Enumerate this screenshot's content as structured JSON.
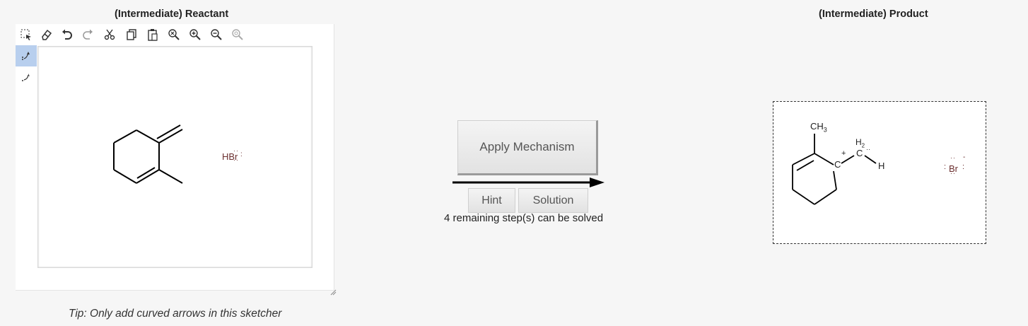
{
  "reactant_panel": {
    "title": "(Intermediate) Reactant",
    "tip": "Tip: Only add curved arrows in this sketcher",
    "toolbar": [
      "select-icon",
      "eraser-icon",
      "undo-icon",
      "redo-icon",
      "cut-icon",
      "copy-icon",
      "paste-icon",
      "clear-icon",
      "zoom-in-icon",
      "zoom-out-icon",
      "zoom-reset-icon"
    ],
    "side_tools": [
      "curved-arrow-electron-pair-icon",
      "curved-arrow-single-electron-icon"
    ],
    "reagent_label": "HBr"
  },
  "mechanism": {
    "apply_label": "Apply Mechanism",
    "hint_label": "Hint",
    "solution_label": "Solution",
    "remaining_text": "4 remaining step(s) can be solved"
  },
  "product_panel": {
    "title": "(Intermediate) Product",
    "methyl_label": "CH",
    "methyl_sub": "3",
    "ch2_label": "H",
    "ch2_sub": "2",
    "ch2_c": "C",
    "carbocation_label": "C",
    "plus_sign": "+",
    "h_label": "H",
    "bromide_label": "Br",
    "minus_sign": "-"
  },
  "colors": {
    "selected_tool_bg": "#b8cfee",
    "lone_pair": "#6b2f2f",
    "arrow": "#000000"
  }
}
